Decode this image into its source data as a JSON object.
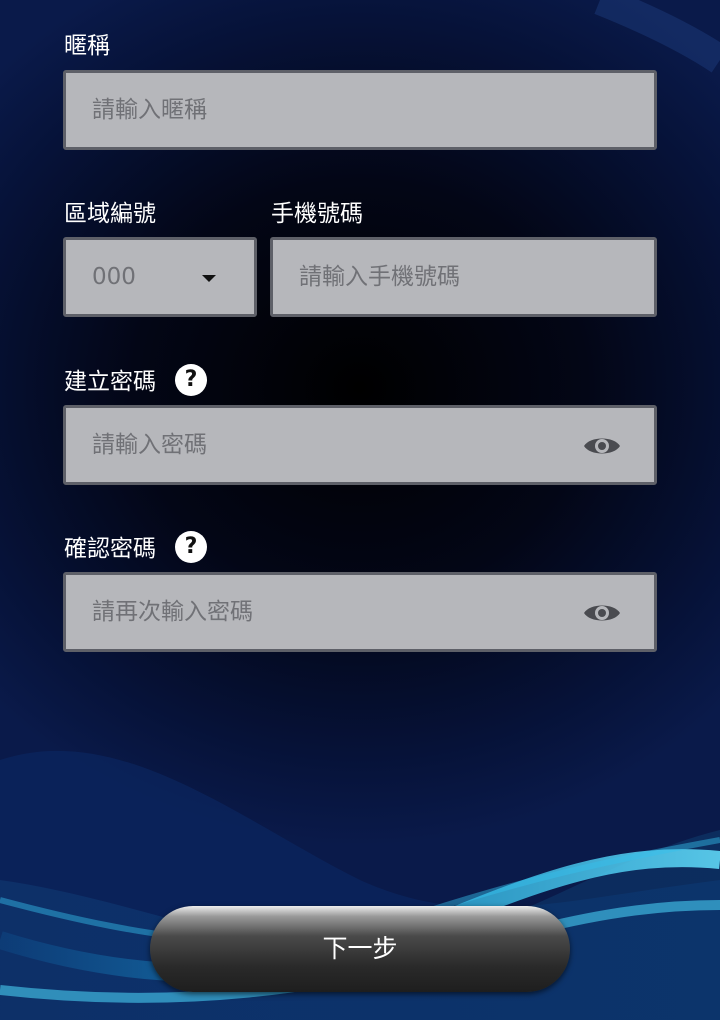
{
  "nickname": {
    "label": "暱稱",
    "placeholder": "請輸入暱稱"
  },
  "area_code": {
    "label": "區域編號",
    "selected": "000"
  },
  "phone": {
    "label": "手機號碼",
    "placeholder": "請輸入手機號碼"
  },
  "create_password": {
    "label": "建立密碼",
    "help_glyph": "?",
    "placeholder": "請輸入密碼"
  },
  "confirm_password": {
    "label": "確認密碼",
    "help_glyph": "?",
    "placeholder": "請再次輸入密碼"
  },
  "next_button": {
    "label": "下一步"
  },
  "colors": {
    "field_bg": "#b6b7bb",
    "field_border": "#5e6068",
    "placeholder": "#707176",
    "label": "#ffffff",
    "wave": "#1ea7d8"
  },
  "icons": [
    "help-icon",
    "eye-icon",
    "caret-down-icon"
  ]
}
